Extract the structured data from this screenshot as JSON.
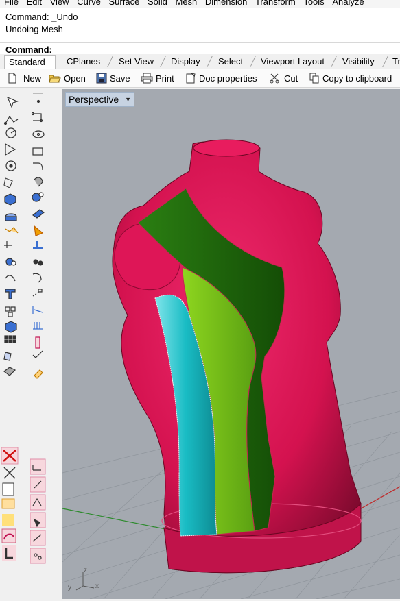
{
  "menu": [
    "File",
    "Edit",
    "View",
    "Curve",
    "Surface",
    "Solid",
    "Mesh",
    "Dimension",
    "Transform",
    "Tools",
    "Analyze"
  ],
  "command_history": [
    "Command: _Undo",
    "Undoing Mesh"
  ],
  "command_prompt": "Command:",
  "tabs": [
    "Standard",
    "CPlanes",
    "Set View",
    "Display",
    "Select",
    "Viewport Layout",
    "Visibility",
    "Tr"
  ],
  "toolbar": {
    "new": "New",
    "open": "Open",
    "save": "Save",
    "print": "Print",
    "doc_properties": "Doc properties",
    "cut": "Cut",
    "copy": "Copy to clipboard"
  },
  "viewport": {
    "name": "Perspective",
    "axis_x": "x",
    "axis_y": "y",
    "axis_z": "z"
  },
  "colors": {
    "body": "#d4124f",
    "panel_dark_green": "#1f6a0c",
    "panel_light_green": "#72c21c",
    "panel_cyan": "#19bcc4",
    "viewport_bg": "#a4a9b0"
  }
}
